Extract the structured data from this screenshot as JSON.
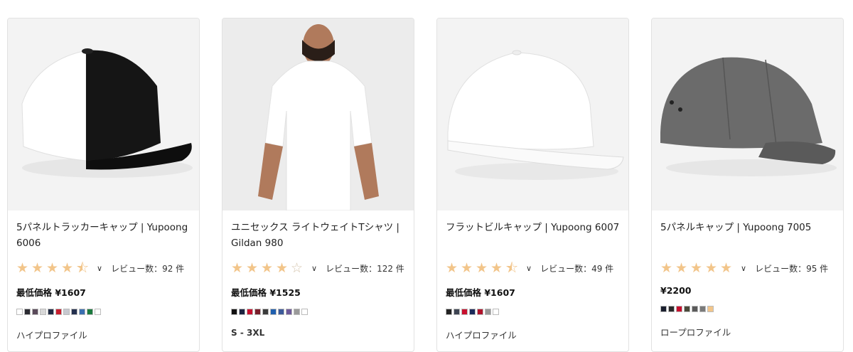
{
  "products": [
    {
      "title": "5パネルトラッカーキャップ | Yupoong 6006",
      "rating": 4.5,
      "reviews": "レビュー数：92 件",
      "price": "最低価格 ¥1607",
      "colors": [
        "#ffffff",
        "#2b2b33",
        "#5a4a5a",
        "#d8d8d8",
        "#1f2a44",
        "#c81e2e",
        "#c7c9d0",
        "#24314f",
        "#3a6fb0",
        "#1b7a3e",
        "#ffffff"
      ],
      "footer": "ハイプロファイル",
      "image": "trucker-cap"
    },
    {
      "title": "ユニセックス ライトウェイトTシャツ | Gildan 980",
      "rating": 4,
      "reviews": "レビュー数：122 件",
      "price": "最低価格 ¥1525",
      "colors": [
        "#111111",
        "#1c2340",
        "#c8102e",
        "#7a1f2b",
        "#3b3b3b",
        "#1f5fae",
        "#3c5a9a",
        "#6e5a9a",
        "#9a9a9a",
        "#ffffff"
      ],
      "footer": "S - 3XL",
      "image": "t-shirt"
    },
    {
      "title": "フラットビルキャップ | Yupoong 6007",
      "rating": 4.5,
      "reviews": "レビュー数：49 件",
      "price": "最低価格 ¥1607",
      "colors": [
        "#222222",
        "#3d4452",
        "#c8102e",
        "#1c2a5a",
        "#b0122a",
        "#9a9a9a",
        "#ffffff"
      ],
      "footer": "ハイプロファイル",
      "image": "flat-bill-cap"
    },
    {
      "title": "5パネルキャップ | Yupoong 7005",
      "rating": 5,
      "reviews": "レビュー数：95 件",
      "price": "¥2200",
      "colors": [
        "#1a1f2e",
        "#2a2a2a",
        "#c8102e",
        "#4a4a3a",
        "#5a5a5a",
        "#7a7a7a",
        "#f2c58a"
      ],
      "footer": "ロープロファイル",
      "image": "five-panel-cap"
    }
  ]
}
